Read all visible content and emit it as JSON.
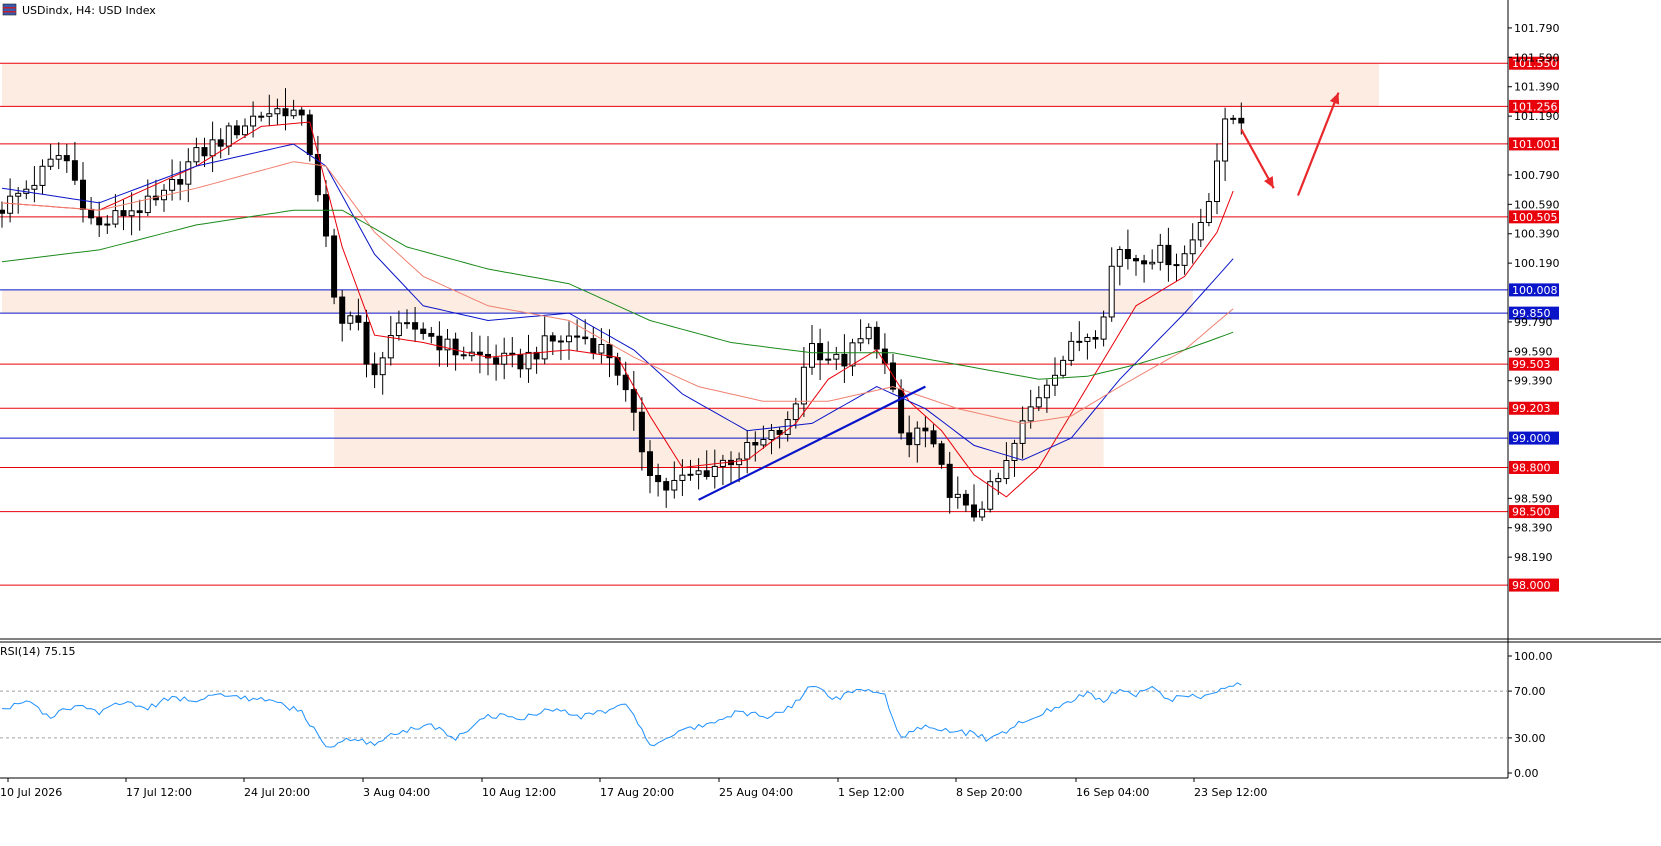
{
  "header": {
    "symbol": "USDindx",
    "timeframe": "H4",
    "description": "USD Index",
    "title_text": "USDindx, H4:  USD Index"
  },
  "chart_data": [
    {
      "type": "candlestick",
      "symbol": "USDindx",
      "timeframe": "H4",
      "ylim": [
        97.64,
        101.98
      ],
      "price_ticks": [
        "101.790",
        "101.590",
        "101.390",
        "101.190",
        "100.790",
        "100.590",
        "100.390",
        "100.190",
        "99.790",
        "99.590",
        "99.390",
        "98.590",
        "98.390",
        "98.190"
      ],
      "time_ticks": [
        "10 Jul 2026",
        "17 Jul 12:00",
        "24 Jul 20:00",
        "3 Aug 04:00",
        "10 Aug 12:00",
        "17 Aug 20:00",
        "25 Aug 04:00",
        "1 Sep 12:00",
        "8 Sep 20:00",
        "16 Sep 04:00",
        "23 Sep 12:00"
      ],
      "levels": [
        {
          "value": 101.55,
          "label": "101.550",
          "kind": "resistance"
        },
        {
          "value": 101.256,
          "label": "101.256",
          "kind": "resistance"
        },
        {
          "value": 101.001,
          "label": "101.001",
          "kind": "resistance"
        },
        {
          "value": 100.505,
          "label": "100.505",
          "kind": "resistance"
        },
        {
          "value": 100.008,
          "label": "100.008",
          "kind": "pivot"
        },
        {
          "value": 99.85,
          "label": "99.850",
          "kind": "pivot"
        },
        {
          "value": 99.503,
          "label": "99.503",
          "kind": "support"
        },
        {
          "value": 99.203,
          "label": "99.203",
          "kind": "support"
        },
        {
          "value": 99.0,
          "label": "99.000",
          "kind": "pivot"
        },
        {
          "value": 98.8,
          "label": "98.800",
          "kind": "support"
        },
        {
          "value": 98.5,
          "label": "98.500",
          "kind": "support"
        },
        {
          "value": 98.0,
          "label": "98.000",
          "kind": "support"
        }
      ],
      "zones": [
        {
          "from_index": 0,
          "to_index": 170,
          "low": 101.256,
          "high": 101.55
        },
        {
          "from_index": 0,
          "to_index": 147,
          "low": 99.85,
          "high": 100.008
        },
        {
          "from_index": 41,
          "to_index": 136,
          "low": 98.8,
          "high": 99.203
        }
      ],
      "close_path": [
        [
          0,
          100.55
        ],
        [
          4,
          100.72
        ],
        [
          8,
          100.95
        ],
        [
          12,
          100.42
        ],
        [
          16,
          100.55
        ],
        [
          20,
          100.6
        ],
        [
          24,
          100.9
        ],
        [
          28,
          101.05
        ],
        [
          32,
          101.2
        ],
        [
          36,
          101.25
        ],
        [
          38,
          101.1
        ],
        [
          40,
          100.55
        ],
        [
          42,
          99.7
        ],
        [
          44,
          99.95
        ],
        [
          46,
          99.3
        ],
        [
          48,
          99.7
        ],
        [
          52,
          99.75
        ],
        [
          56,
          99.6
        ],
        [
          60,
          99.55
        ],
        [
          64,
          99.5
        ],
        [
          68,
          99.65
        ],
        [
          72,
          99.7
        ],
        [
          76,
          99.55
        ],
        [
          80,
          98.85
        ],
        [
          82,
          98.65
        ],
        [
          86,
          98.75
        ],
        [
          90,
          98.85
        ],
        [
          94,
          98.95
        ],
        [
          98,
          99.1
        ],
        [
          100,
          99.65
        ],
        [
          104,
          99.5
        ],
        [
          108,
          99.75
        ],
        [
          110,
          99.4
        ],
        [
          112,
          98.9
        ],
        [
          114,
          99.1
        ],
        [
          117,
          98.7
        ],
        [
          120,
          98.45
        ],
        [
          124,
          98.75
        ],
        [
          127,
          99.15
        ],
        [
          130,
          99.45
        ],
        [
          134,
          99.7
        ],
        [
          136,
          99.75
        ],
        [
          138,
          100.3
        ],
        [
          140,
          100.22
        ],
        [
          142,
          100.25
        ],
        [
          144,
          100.25
        ],
        [
          146,
          100.2
        ],
        [
          148,
          100.4
        ],
        [
          150,
          100.75
        ],
        [
          151,
          101.05
        ],
        [
          152,
          101.18
        ]
      ],
      "indicators": [
        {
          "kind": "ema",
          "period": 10,
          "color": "#e8000b",
          "path": [
            [
              0,
              100.6
            ],
            [
              12,
              100.55
            ],
            [
              24,
              100.85
            ],
            [
              32,
              101.12
            ],
            [
              38,
              101.15
            ],
            [
              42,
              100.3
            ],
            [
              46,
              99.7
            ],
            [
              52,
              99.65
            ],
            [
              60,
              99.55
            ],
            [
              70,
              99.6
            ],
            [
              76,
              99.55
            ],
            [
              80,
              99.15
            ],
            [
              84,
              98.8
            ],
            [
              92,
              98.85
            ],
            [
              98,
              99.1
            ],
            [
              102,
              99.4
            ],
            [
              108,
              99.6
            ],
            [
              112,
              99.25
            ],
            [
              116,
              99.05
            ],
            [
              120,
              98.75
            ],
            [
              124,
              98.6
            ],
            [
              128,
              98.8
            ],
            [
              134,
              99.35
            ],
            [
              140,
              99.9
            ],
            [
              146,
              100.1
            ],
            [
              150,
              100.4
            ],
            [
              152,
              100.68
            ]
          ]
        },
        {
          "kind": "ema",
          "period": 34,
          "color": "#0a14c8",
          "path": [
            [
              0,
              100.7
            ],
            [
              12,
              100.6
            ],
            [
              24,
              100.85
            ],
            [
              36,
              101.0
            ],
            [
              40,
              100.85
            ],
            [
              46,
              100.25
            ],
            [
              52,
              99.9
            ],
            [
              60,
              99.8
            ],
            [
              70,
              99.85
            ],
            [
              78,
              99.6
            ],
            [
              84,
              99.3
            ],
            [
              92,
              99.05
            ],
            [
              100,
              99.1
            ],
            [
              108,
              99.35
            ],
            [
              114,
              99.2
            ],
            [
              120,
              98.95
            ],
            [
              126,
              98.85
            ],
            [
              132,
              99.0
            ],
            [
              138,
              99.4
            ],
            [
              146,
              99.85
            ],
            [
              152,
              100.22
            ]
          ]
        },
        {
          "kind": "ema",
          "period": 55,
          "color": "#f08070",
          "path": [
            [
              0,
              100.6
            ],
            [
              12,
              100.55
            ],
            [
              24,
              100.7
            ],
            [
              36,
              100.88
            ],
            [
              40,
              100.85
            ],
            [
              46,
              100.4
            ],
            [
              52,
              100.1
            ],
            [
              60,
              99.9
            ],
            [
              70,
              99.8
            ],
            [
              78,
              99.55
            ],
            [
              86,
              99.35
            ],
            [
              94,
              99.25
            ],
            [
              102,
              99.25
            ],
            [
              110,
              99.35
            ],
            [
              118,
              99.2
            ],
            [
              126,
              99.1
            ],
            [
              132,
              99.15
            ],
            [
              138,
              99.35
            ],
            [
              146,
              99.6
            ],
            [
              152,
              99.88
            ]
          ]
        },
        {
          "kind": "ema",
          "period": 200,
          "color": "#1a8a1a",
          "path": [
            [
              0,
              100.2
            ],
            [
              12,
              100.28
            ],
            [
              24,
              100.45
            ],
            [
              36,
              100.55
            ],
            [
              42,
              100.55
            ],
            [
              50,
              100.3
            ],
            [
              60,
              100.15
            ],
            [
              70,
              100.05
            ],
            [
              80,
              99.8
            ],
            [
              90,
              99.65
            ],
            [
              100,
              99.58
            ],
            [
              110,
              99.58
            ],
            [
              120,
              99.48
            ],
            [
              128,
              99.4
            ],
            [
              134,
              99.42
            ],
            [
              140,
              99.5
            ],
            [
              146,
              99.6
            ],
            [
              152,
              99.72
            ]
          ]
        }
      ],
      "trendline": {
        "color": "#0a14c8",
        "from": [
          86,
          98.58
        ],
        "to": [
          114,
          99.35
        ]
      },
      "arrows": [
        {
          "color": "#e8282b",
          "from": [
            153,
            101.1
          ],
          "to": [
            157,
            100.7
          ]
        },
        {
          "color": "#e8282b",
          "from": [
            160,
            100.65
          ],
          "to": [
            165,
            101.35
          ]
        }
      ]
    },
    {
      "type": "line",
      "title": "RSI(14) 75.15",
      "ylim": [
        0,
        100
      ],
      "y_ticks": [
        "100.00",
        "70.00",
        "30.00",
        "0.00"
      ],
      "levels": [
        70,
        30
      ],
      "color": "#1e90ff",
      "series_path": [
        [
          0,
          55
        ],
        [
          3,
          62
        ],
        [
          6,
          48
        ],
        [
          9,
          57
        ],
        [
          12,
          52
        ],
        [
          15,
          60
        ],
        [
          18,
          55
        ],
        [
          21,
          65
        ],
        [
          24,
          62
        ],
        [
          27,
          68
        ],
        [
          30,
          64
        ],
        [
          33,
          62
        ],
        [
          37,
          52
        ],
        [
          40,
          22
        ],
        [
          43,
          30
        ],
        [
          46,
          25
        ],
        [
          49,
          35
        ],
        [
          53,
          40
        ],
        [
          56,
          30
        ],
        [
          60,
          50
        ],
        [
          64,
          46
        ],
        [
          68,
          55
        ],
        [
          71,
          48
        ],
        [
          74,
          52
        ],
        [
          77,
          60
        ],
        [
          80,
          23
        ],
        [
          83,
          35
        ],
        [
          87,
          42
        ],
        [
          91,
          52
        ],
        [
          95,
          48
        ],
        [
          98,
          60
        ],
        [
          100,
          76
        ],
        [
          103,
          63
        ],
        [
          106,
          72
        ],
        [
          109,
          66
        ],
        [
          111,
          30
        ],
        [
          114,
          40
        ],
        [
          117,
          35
        ],
        [
          120,
          34
        ],
        [
          122,
          28
        ],
        [
          125,
          40
        ],
        [
          128,
          50
        ],
        [
          131,
          58
        ],
        [
          134,
          68
        ],
        [
          136,
          62
        ],
        [
          138,
          72
        ],
        [
          140,
          66
        ],
        [
          142,
          74
        ],
        [
          144,
          62
        ],
        [
          146,
          66
        ],
        [
          148,
          65
        ],
        [
          150,
          70
        ],
        [
          152,
          76
        ],
        [
          153,
          74
        ]
      ]
    }
  ],
  "colors": {
    "background": "#ffffff",
    "resistance_line": "#e8000b",
    "pivot_line": "#0a14c8",
    "zone_fill": "#fce9dc",
    "candle": "#000000",
    "grid": "#c8c8c8"
  },
  "icons": {
    "symbol_flag": "us-flag-icon"
  }
}
